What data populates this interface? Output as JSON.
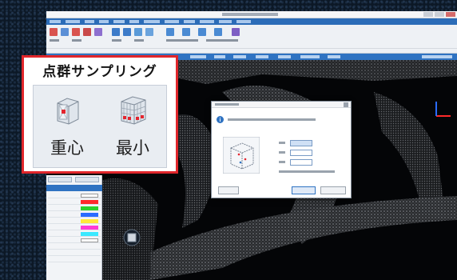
{
  "callout": {
    "title": "点群サンプリング",
    "buttons": [
      {
        "id": "centroid",
        "label": "重心",
        "icon": "centroid-cube-icon"
      },
      {
        "id": "minimum",
        "label": "最小",
        "icon": "minimum-grid-cube-icon"
      }
    ]
  },
  "colors": {
    "callout_border": "#e0262b",
    "menubar": "#2b6cb8",
    "viewport_bg": "#040507",
    "icon_red": "#e3262f"
  },
  "left_panel_swatches": [
    "#ffffff",
    "#ff2a2a",
    "#2cd12c",
    "#2a6bff",
    "#ffe93a",
    "#ff3ad6",
    "#3ae9ff",
    "#ffffff"
  ]
}
